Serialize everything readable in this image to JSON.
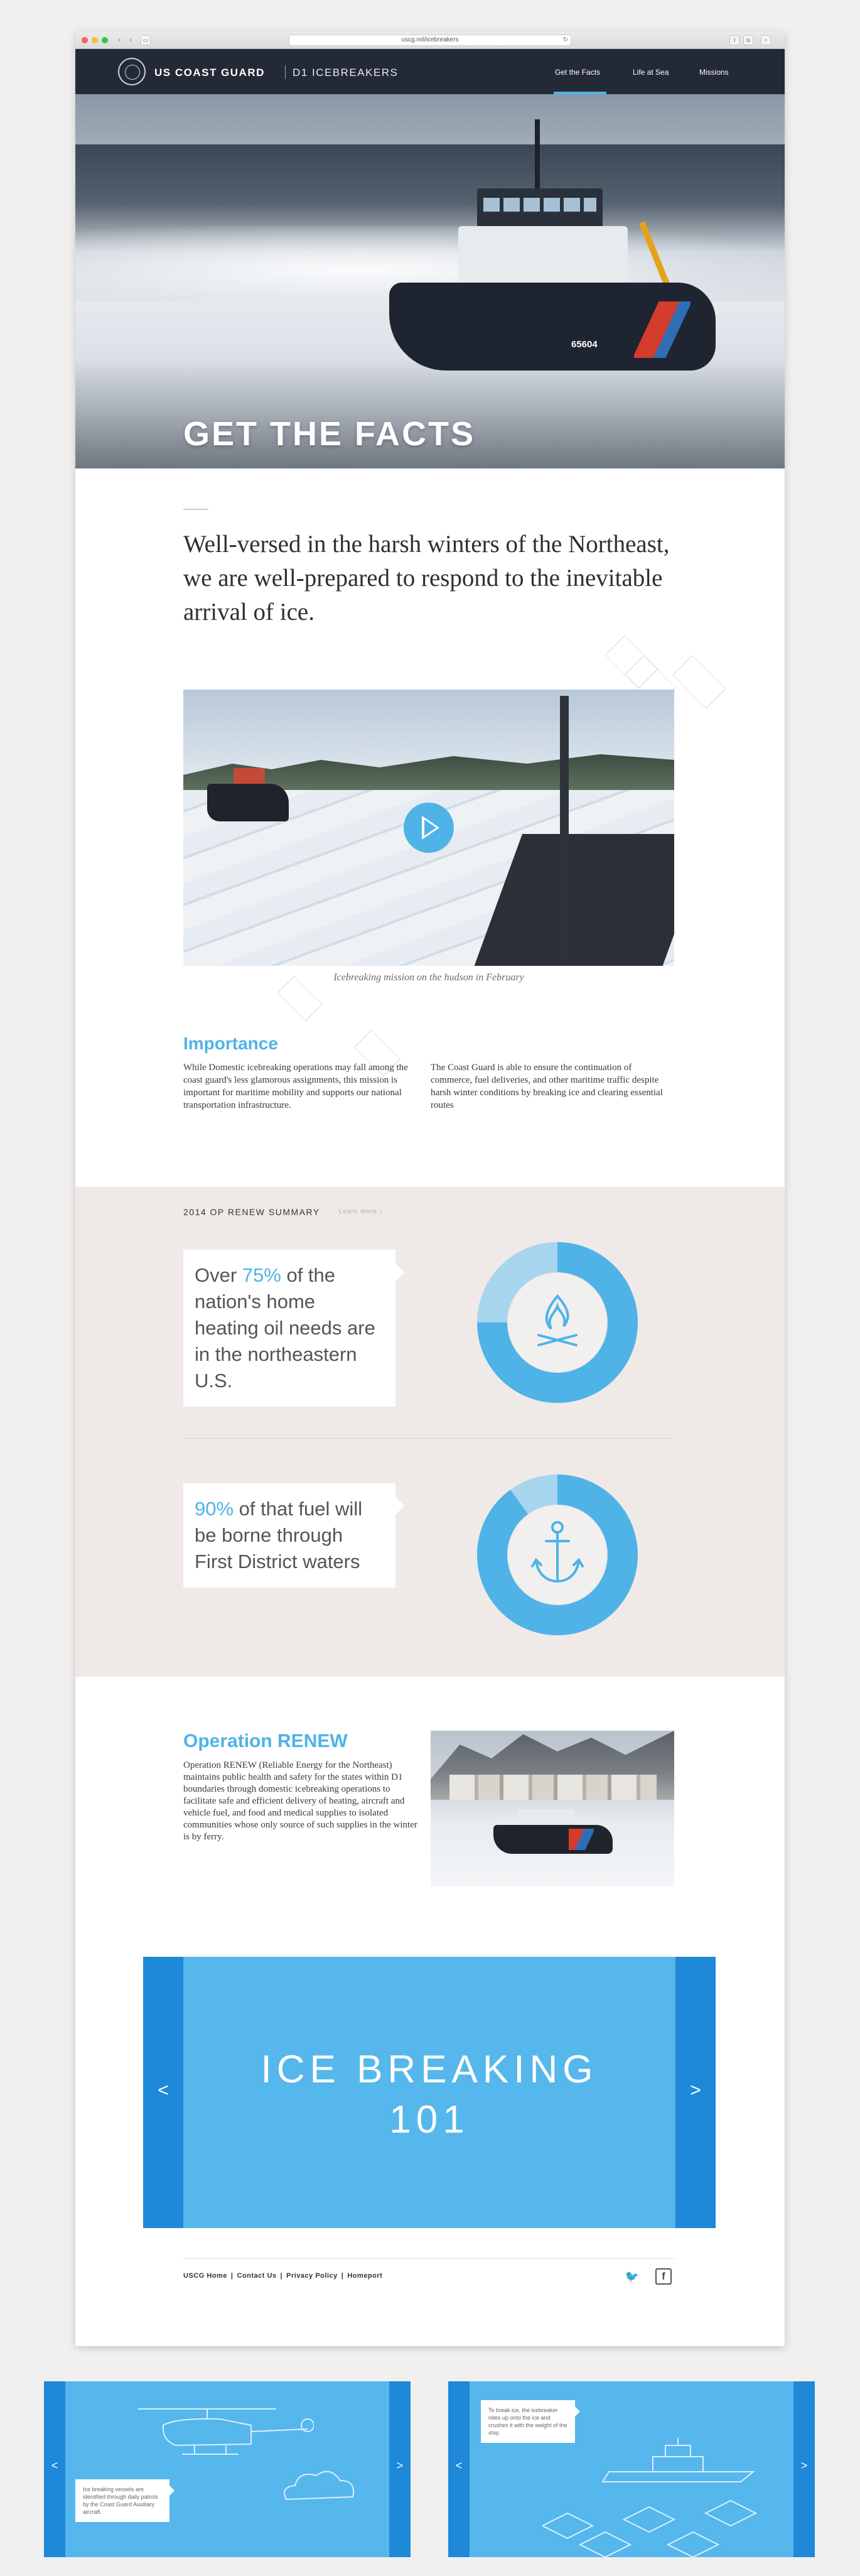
{
  "browser": {
    "url": "uscg.mil/icebreakers",
    "back_glyph": "‹",
    "forward_glyph": "›",
    "sidebar_glyph": "▭",
    "reload_glyph": "↻",
    "share_glyph": "⇪",
    "tabs_glyph": "⧉",
    "add_glyph": "+"
  },
  "header": {
    "brand": "US COAST GUARD",
    "sub_brand": "D1 ICEBREAKERS",
    "nav": [
      "Get the Facts",
      "Life at Sea",
      "Missions"
    ],
    "active_nav": "Get the Facts"
  },
  "hero": {
    "title": "GET THE FACTS",
    "hull_number": "65604"
  },
  "intro": {
    "text": "Well-versed in the harsh winters of the Northeast, we are well-prepared to respond to the inevitable arrival of ice."
  },
  "video": {
    "caption": "Icebreaking mission on the hudson in February"
  },
  "importance": {
    "title": "Importance",
    "col1": "While Domestic icebreaking operations may fall among the coast guard's less glamorous assignments, this mission is important for maritime mobility and supports our national transportation infrastructure.",
    "col2": "The Coast Guard is able to ensure the continuation of commerce, fuel deliveries, and other maritime traffic despite harsh winter conditions by breaking ice and clearing essential routes"
  },
  "summary": {
    "heading": "2014 OP RENEW SUMMARY",
    "link": "Learn more ›",
    "stats": [
      {
        "prefix": "Over ",
        "highlight": "75%",
        "suffix": " of the nation's home heating oil needs are in the northeastern U.S.",
        "percent": 75,
        "icon": "campfire-icon"
      },
      {
        "prefix": "",
        "highlight": "90%",
        "suffix": " of that fuel will be borne through First District waters",
        "percent": 90,
        "icon": "anchor-icon"
      }
    ]
  },
  "operation": {
    "title": "Operation RENEW",
    "body": "Operation RENEW (Reliable Energy for the Northeast) maintains public health and safety for the states within D1 boundaries through domestic icebreaking operations to facilitate safe and efficient delivery of heating, aircraft and vehicle fuel, and food and medical supplies to isolated communities whose only source of such supplies in the winter is by ferry."
  },
  "slider": {
    "title_line1": "ICE BREAKING",
    "title_line2": "101",
    "prev": "<",
    "next": ">"
  },
  "footer": {
    "links": [
      "USCG Home",
      "Contact Us",
      "Privacy Policy",
      "Homeport"
    ],
    "separator": "|",
    "twitter_glyph": "🐦",
    "facebook_glyph": "f"
  },
  "previews": [
    {
      "note": "Ice breaking vessels are identified through daily patrols by the Coast Guard Auxiliary aircraft.",
      "prev": "<",
      "next": ">"
    },
    {
      "note": "To break ice, the icebreaker rides up onto the ice and crushes it with the weight of the ship.",
      "prev": "<",
      "next": ">"
    }
  ],
  "colors": {
    "accent": "#4fb3e8",
    "navy": "#232a36",
    "slider_bg": "#55b7ec",
    "slider_side": "#1e88d9",
    "donut_light": "#a8d5ee",
    "summary_bg": "#efeae8"
  }
}
